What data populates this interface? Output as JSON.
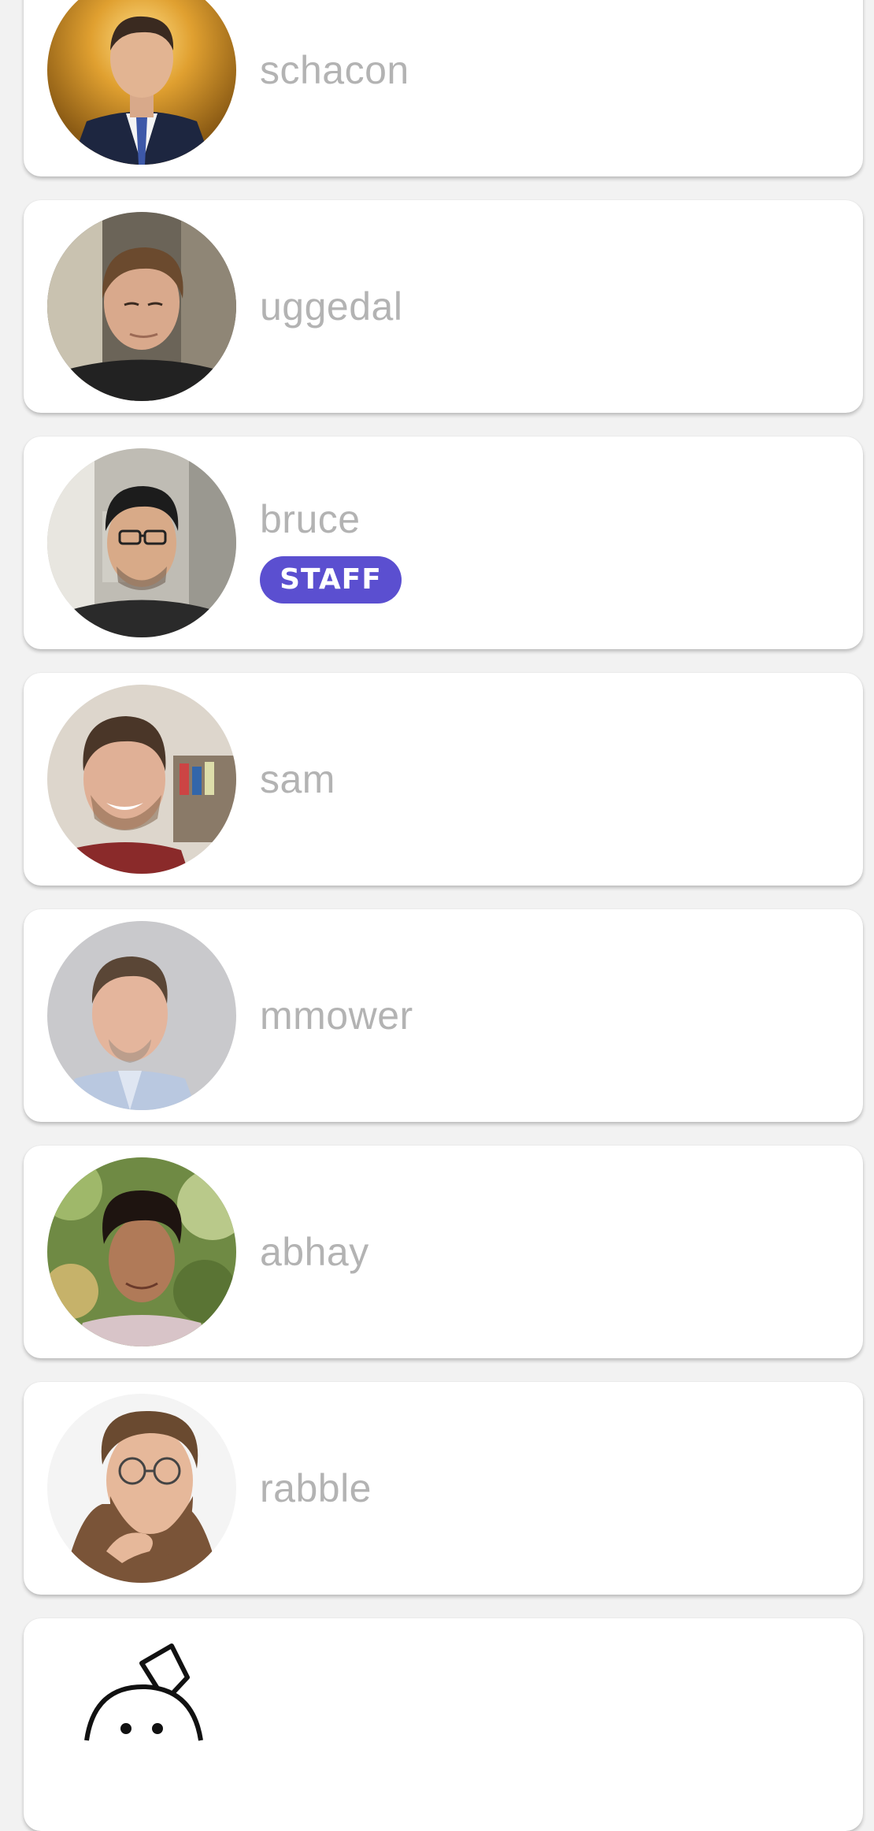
{
  "members": [
    {
      "username": "schacon",
      "avatar_icon": "avatar-photo-schacon"
    },
    {
      "username": "uggedal",
      "avatar_icon": "avatar-photo-uggedal"
    },
    {
      "username": "bruce",
      "avatar_icon": "avatar-photo-bruce",
      "badge": "STAFF"
    },
    {
      "username": "sam",
      "avatar_icon": "avatar-photo-sam"
    },
    {
      "username": "mmower",
      "avatar_icon": "avatar-photo-mmower"
    },
    {
      "username": "abhay",
      "avatar_icon": "avatar-photo-abhay"
    },
    {
      "username": "rabble",
      "avatar_icon": "avatar-photo-rabble"
    },
    {
      "avatar_icon": "avatar-cartoon-chef"
    }
  ],
  "colors": {
    "card_background": "#ffffff",
    "page_background": "#f2f2f2",
    "username_text": "#b3b3b3",
    "staff_badge": "#5b4fd0"
  }
}
